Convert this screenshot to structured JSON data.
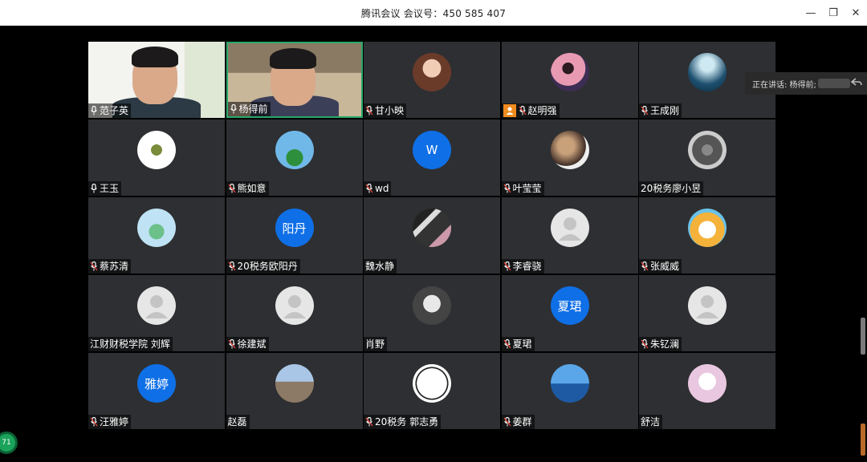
{
  "window": {
    "title": "腾讯会议  会议号：450 585 407",
    "minimize": "—",
    "restore": "❐",
    "close": "✕"
  },
  "speaking": {
    "label": "正在讲话: 杨得前;"
  },
  "badge": {
    "count": "71"
  },
  "participants": [
    {
      "name": "范子英",
      "kind": "video",
      "mic": "on"
    },
    {
      "name": "杨得前",
      "kind": "video",
      "mic": "on",
      "active": true
    },
    {
      "name": "甘小映",
      "kind": "photo",
      "mic": "off"
    },
    {
      "name": "赵明强",
      "kind": "photo",
      "mic": "off",
      "host": true
    },
    {
      "name": "王成刚",
      "kind": "photo",
      "mic": "off"
    },
    {
      "name": "王玉",
      "kind": "photo",
      "mic": "on"
    },
    {
      "name": "熊如意",
      "kind": "photo",
      "mic": "off"
    },
    {
      "name": "wd",
      "kind": "text",
      "avatar_text": "W",
      "mic": "off"
    },
    {
      "name": "叶莹莹",
      "kind": "photo",
      "mic": "off"
    },
    {
      "name": "20税务廖小昱",
      "kind": "photo",
      "mic": "none"
    },
    {
      "name": "蔡苏清",
      "kind": "photo",
      "mic": "off"
    },
    {
      "name": "20税务欧阳丹",
      "kind": "text",
      "avatar_text": "阳丹",
      "mic": "off"
    },
    {
      "name": "魏水静",
      "kind": "photo",
      "mic": "none"
    },
    {
      "name": "李睿骁",
      "kind": "default",
      "mic": "off"
    },
    {
      "name": "张威威",
      "kind": "photo",
      "mic": "off"
    },
    {
      "name": "江财财税学院 刘辉",
      "kind": "default",
      "mic": "none"
    },
    {
      "name": "徐建斌",
      "kind": "default",
      "mic": "off"
    },
    {
      "name": "肖野",
      "kind": "photo",
      "mic": "none"
    },
    {
      "name": "夏珺",
      "kind": "text",
      "avatar_text": "夏珺",
      "mic": "off"
    },
    {
      "name": "朱钇澜",
      "kind": "default",
      "mic": "off"
    },
    {
      "name": "汪雅婷",
      "kind": "text",
      "avatar_text": "雅婷",
      "mic": "off"
    },
    {
      "name": "赵磊",
      "kind": "photo",
      "mic": "none"
    },
    {
      "name": "20税务 郭志勇",
      "kind": "photo",
      "mic": "off"
    },
    {
      "name": "姜群",
      "kind": "photo",
      "mic": "off"
    },
    {
      "name": "舒洁",
      "kind": "photo",
      "mic": "none"
    }
  ],
  "colors": {
    "avatar_blue": "#0f6fe6",
    "tile_bg": "#2e2f32",
    "active_border": "#2aa86a",
    "mic_muted": "#e0443a"
  }
}
